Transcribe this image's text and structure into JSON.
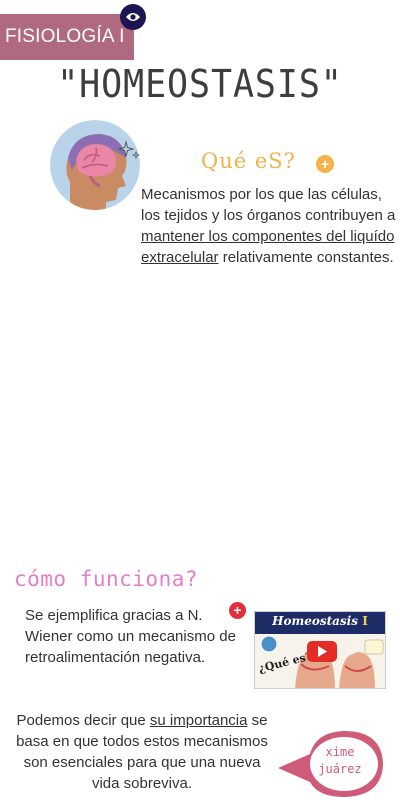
{
  "header": {
    "course": "FISIOLOGÍA I",
    "title": "\"HOMEOSTASIS\""
  },
  "eye_icon": "eye-icon",
  "section1": {
    "heading": "Qué eS?",
    "add_label": "+",
    "text_before": "Mecanismos por los que las células, los tejidos y los órganos contribuyen a ",
    "text_link": "mantener los componentes del liquído extracelular",
    "text_after": " relativamente constantes."
  },
  "section2": {
    "heading": "cómo funciona?",
    "add_label": "+",
    "text": "Se ejemplifica gracias a N. Wiener como un mecanismo de retroalimentación negativa.",
    "video": {
      "title": "Homeostasis",
      "title_suffix": "I",
      "question": "¿Qué es?"
    }
  },
  "section3": {
    "text_before": "Podemos decir que ",
    "text_link": "su importancia",
    "text_after": " se basa en que todos estos mecanismos son esenciales para que una nueva vida sobreviva."
  },
  "author": {
    "line1": "xime",
    "line2": "juárez"
  },
  "colors": {
    "banner": "#b06a80",
    "accent_orange": "#f0b14a",
    "accent_pink": "#e57fc5",
    "eye_button": "#1b1651",
    "add_red": "#e0303c",
    "bubble": "#d05b78"
  }
}
